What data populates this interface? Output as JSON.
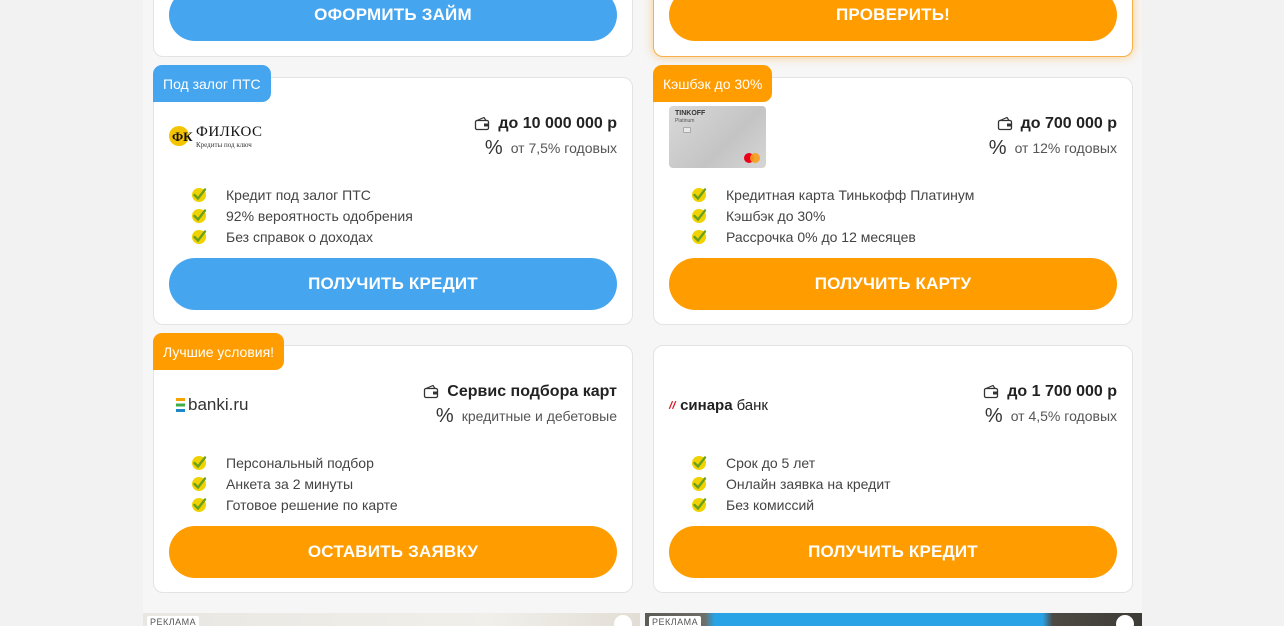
{
  "top_buttons": {
    "left": "ОФОРМИТЬ ЗАЙМ",
    "right": "ПРОВЕРИТЬ!"
  },
  "offers": [
    {
      "badge": "Под залог ПТС",
      "logo": {
        "name": "ФИЛКОС",
        "tagline": "Кредиты под ключ"
      },
      "amount": "до 10 000 000 р",
      "rate": "от 7,5% годовых",
      "features": [
        "Кредит под залог ПТС",
        "92% вероятность одобрения",
        "Без справок о доходах"
      ],
      "button": "ПОЛУЧИТЬ КРЕДИТ"
    },
    {
      "badge": "Кэшбэк до 30%",
      "logo": {
        "name": "TINKOFF",
        "tagline": "Platinum"
      },
      "amount": "до 700 000 р",
      "rate": "от 12% годовых",
      "features": [
        "Кредитная карта Тинькофф Платинум",
        "Кэшбэк до 30%",
        "Рассрочка 0% до 12 месяцев"
      ],
      "button": "ПОЛУЧИТЬ КАРТУ"
    },
    {
      "badge": "Лучшие условия!",
      "logo": {
        "name": "banki.ru"
      },
      "amount": "Сервис подбора карт",
      "rate": "кредитные и дебетовые",
      "features": [
        "Персональный подбор",
        "Анкета за 2 минуты",
        "Готовое решение по карте"
      ],
      "button": "ОСТАВИТЬ ЗАЯВКУ"
    },
    {
      "logo": {
        "name": "синара",
        "suffix": "банк"
      },
      "amount": "до 1 700 000 р",
      "rate": "от 4,5% годовых",
      "features": [
        "Срок до 5 лет",
        "Онлайн заявка на кредит",
        "Без комиссий"
      ],
      "button": "ПОЛУЧИТЬ КРЕДИТ"
    }
  ],
  "ads": {
    "label": "РЕКЛАМА"
  },
  "colors": {
    "blue": "#45a5ef",
    "orange": "#ff9c00",
    "check": "#f0d200"
  },
  "icons": {
    "amount": "wallet-icon",
    "rate": "percent-icon",
    "feature": "checkmark-icon"
  }
}
